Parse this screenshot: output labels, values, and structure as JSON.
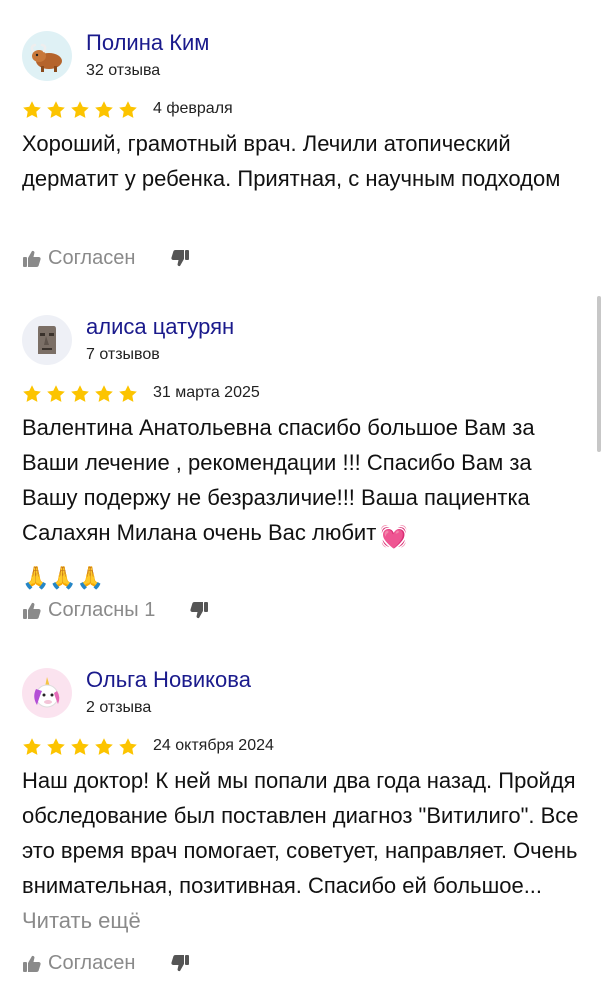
{
  "reviews": [
    {
      "author": "Полина Ким",
      "reviews_count": "32 отзыва",
      "rating": 5,
      "date": "4 февраля",
      "text": "Хороший, грамотный врач. Лечили атопический дерматит у ребенка. Приятная, с научным подходом",
      "agree_label": "Согласен",
      "avatar_icon": "yak-icon"
    },
    {
      "author": "алиса цатурян",
      "reviews_count": "7 отзывов",
      "rating": 5,
      "date": "31 марта 2025",
      "text": "Валентина Анатольевна спасибо большое Вам за Ваши лечение , рекомендации !!! Спасибо Вам за Вашу подержу не безразличие!!! Ваша пациентка Салахян Милана очень Вас любит",
      "emoji_heart": "💓",
      "emoji_hands": "🙏🙏🙏",
      "agree_label": "Согласны 1",
      "avatar_icon": "moai-icon"
    },
    {
      "author": "Ольга Новикова",
      "reviews_count": "2 отзыва",
      "rating": 5,
      "date": "24 октября 2024",
      "text": "Наш доктор! К ней мы попали два года назад. Пройдя обследование был поставлен диагноз \"Витилиго\". Все это время врач помогает, советует, направляет. Очень внимательная, позитивная. Спасибо ей большое...",
      "read_more": "Читать ещё",
      "agree_label": "Согласен",
      "avatar_icon": "unicorn-icon"
    }
  ],
  "colors": {
    "author_name": "#1a1a8c",
    "star": "#fcc400",
    "muted": "#8a8a8a"
  }
}
